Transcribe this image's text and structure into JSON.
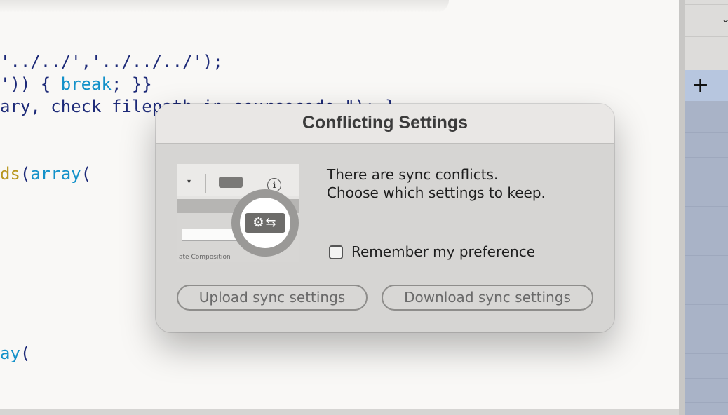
{
  "editor": {
    "lines": [
      {
        "id": "l1",
        "tokens": [
          {
            "t": "'../../','../../../');",
            "c": "plain"
          }
        ]
      },
      {
        "id": "l2",
        "tokens": [
          {
            "t": "')) { ",
            "c": "plain"
          },
          {
            "t": "break",
            "c": "kw"
          },
          {
            "t": "; }}",
            "c": "plain"
          }
        ]
      },
      {
        "id": "l3",
        "tokens": [
          {
            "t": "ary, check filepath in sourcecode.\"); }",
            "c": "plain"
          }
        ]
      },
      {
        "id": "l4",
        "tokens": [
          {
            "t": "ds",
            "c": "fn"
          },
          {
            "t": "(",
            "c": "plain"
          },
          {
            "t": "array",
            "c": "kw"
          },
          {
            "t": "(",
            "c": "plain"
          }
        ]
      },
      {
        "id": "l5",
        "tokens": [
          {
            "t": "ay",
            "c": "kw"
          },
          {
            "t": "(",
            "c": "plain"
          }
        ]
      }
    ]
  },
  "right_panel": {
    "chevron_icon": "chevron-down-icon",
    "add_icon": "plus-icon",
    "add_glyph": "+"
  },
  "dialog": {
    "title": "Conflicting Settings",
    "message_line1": "There are sync conflicts.",
    "message_line2": "Choose which settings to keep.",
    "remember_label": "Remember my preference",
    "remember_checked": false,
    "upload_button": "Upload sync settings",
    "download_button": "Download sync settings",
    "preview": {
      "icon": "sync-settings-gear-icon",
      "info_icon": "info-icon",
      "caption": "ate Composition"
    }
  },
  "colors": {
    "code_plain": "#1d2a78",
    "code_keyword": "#1391c9",
    "code_function": "#b8961e",
    "panel_blue": "#a9b3c7"
  }
}
